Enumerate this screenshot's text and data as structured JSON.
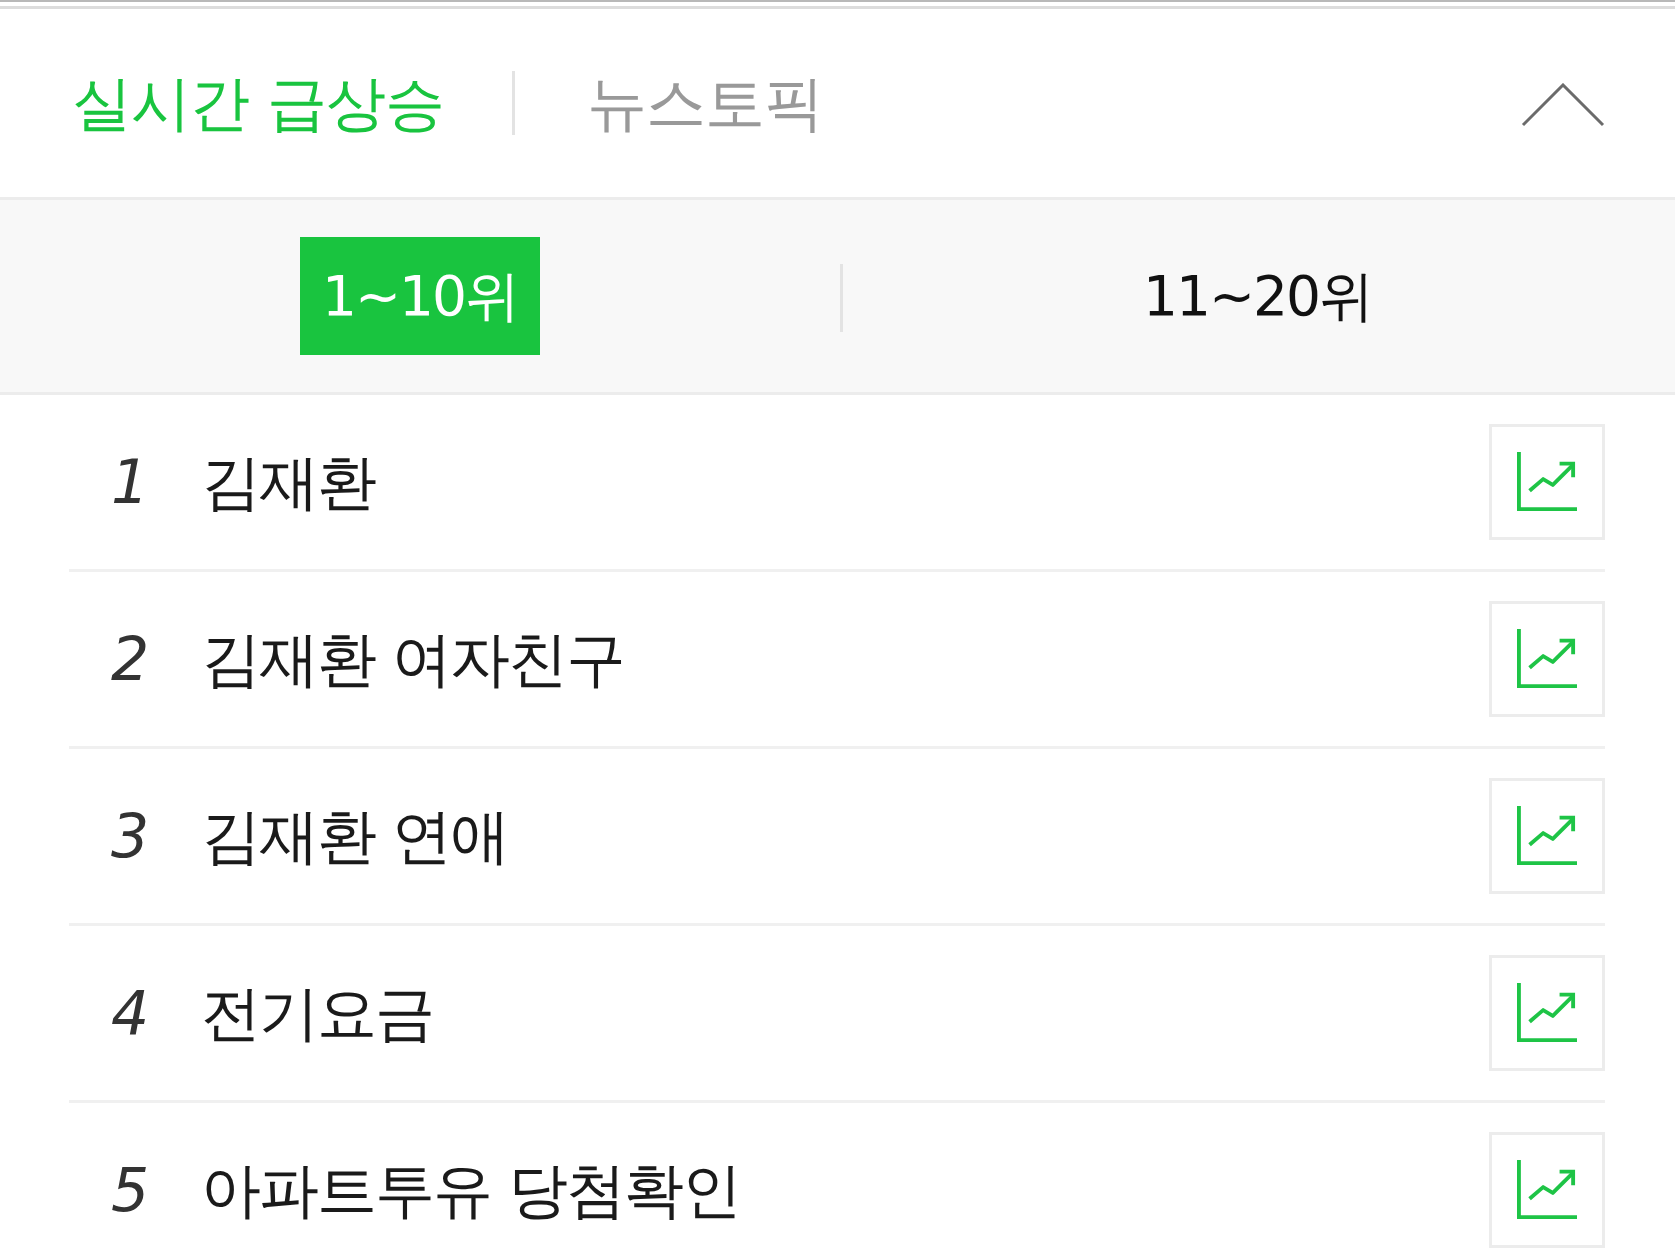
{
  "header": {
    "tabs": [
      {
        "label": "실시간 급상승",
        "selected": true
      },
      {
        "label": "뉴스토픽",
        "selected": false
      }
    ],
    "expanded": true
  },
  "range_tabs": [
    {
      "label": "1~10위",
      "selected": true
    },
    {
      "label": "11~20위",
      "selected": false
    }
  ],
  "rows": [
    {
      "rank": "1",
      "keyword": "김재환"
    },
    {
      "rank": "2",
      "keyword": "김재환 여자친구"
    },
    {
      "rank": "3",
      "keyword": "김재환 연애"
    },
    {
      "rank": "4",
      "keyword": "전기요금"
    },
    {
      "rank": "5",
      "keyword": "아파트투유 당첨확인"
    }
  ]
}
